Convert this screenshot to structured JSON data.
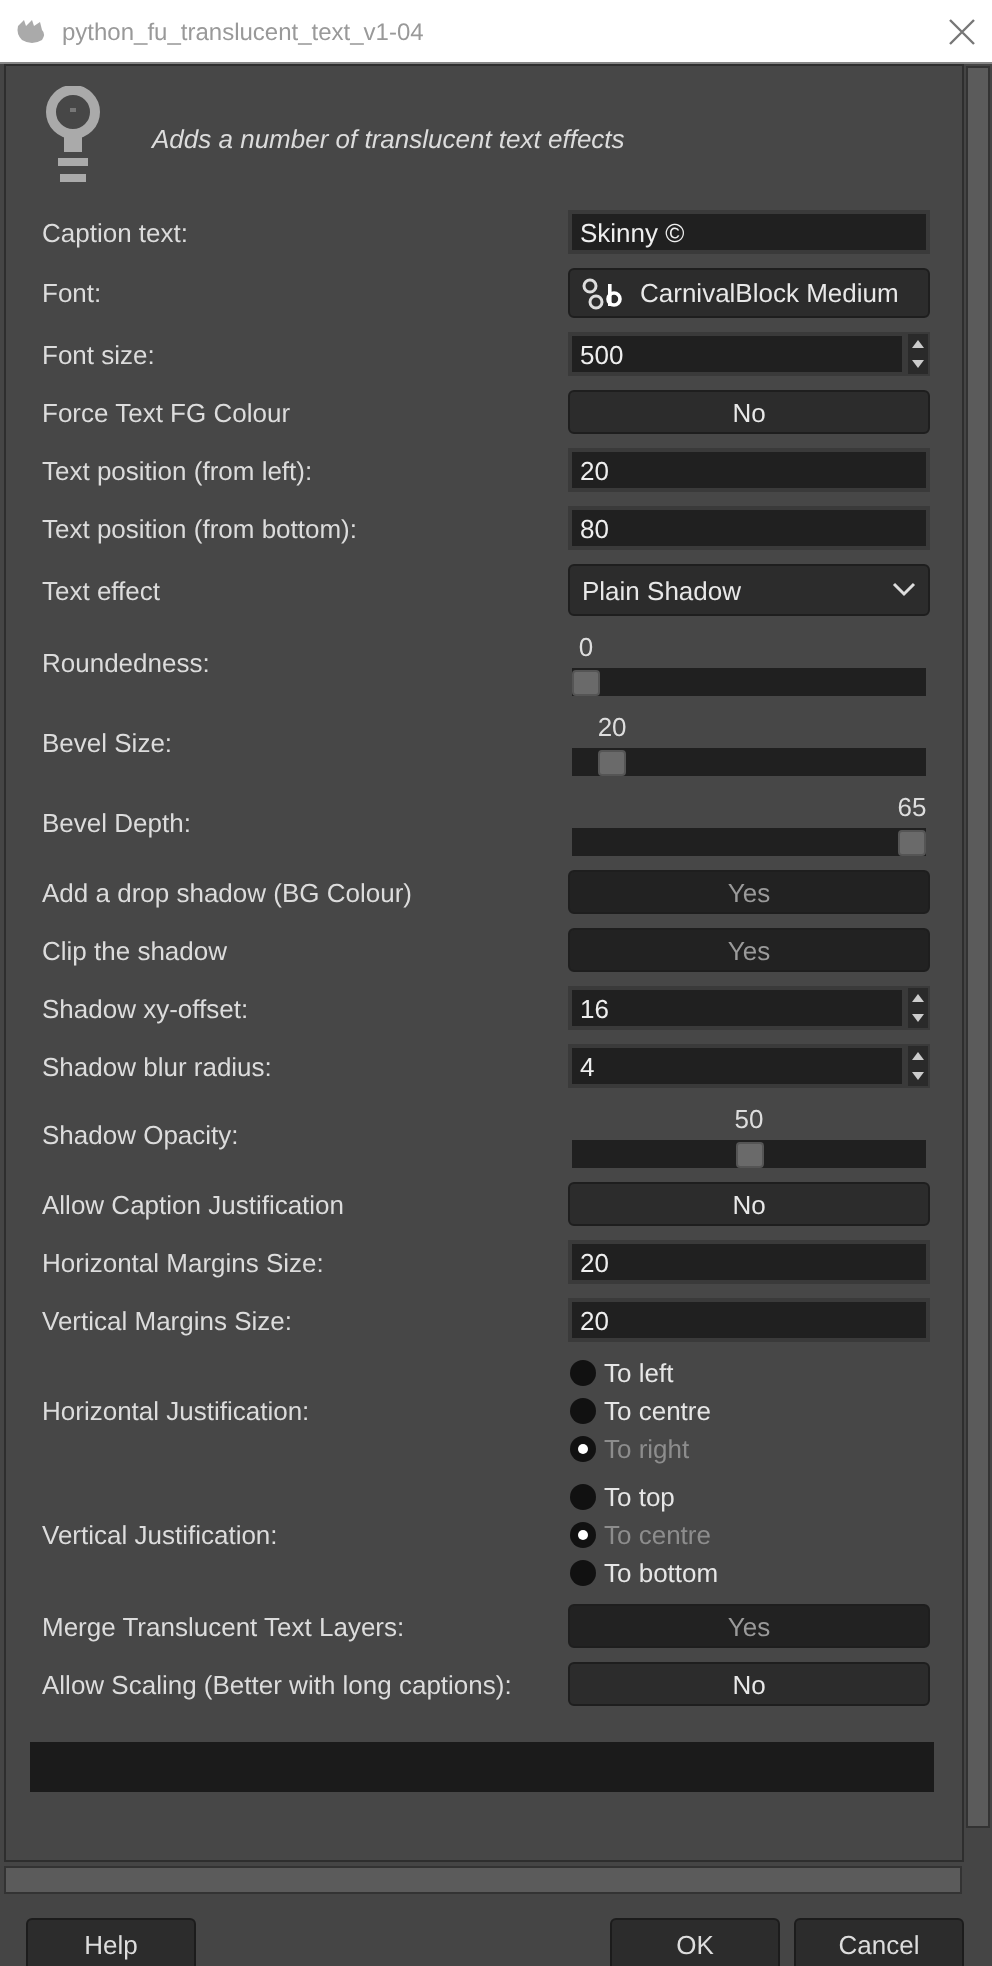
{
  "window": {
    "title": "python_fu_translucent_text_v1-04"
  },
  "description": "Adds a number of translucent text effects",
  "params": [
    {
      "kind": "text",
      "label": "Caption text:",
      "value": "Skinny ©"
    },
    {
      "kind": "font",
      "label": "Font:",
      "value": "CarnivalBlock Medium"
    },
    {
      "kind": "spin",
      "label": "Font size:",
      "value": "500"
    },
    {
      "kind": "toggle",
      "label": "Force Text FG Colour",
      "value": "No",
      "on": false
    },
    {
      "kind": "text",
      "label": "Text position (from left):",
      "value": "20"
    },
    {
      "kind": "text",
      "label": "Text position (from bottom):",
      "value": "80"
    },
    {
      "kind": "combo",
      "label": "Text effect",
      "value": "Plain Shadow"
    },
    {
      "kind": "slider",
      "label": "Roundedness:",
      "reading": "0",
      "level": 0
    },
    {
      "kind": "slider",
      "label": "Bevel Size:",
      "reading": "20",
      "level": 0.08
    },
    {
      "kind": "slider",
      "label": "Bevel Depth:",
      "reading": "65",
      "level": 1
    },
    {
      "kind": "toggle",
      "label": "Add a drop shadow (BG Colour)",
      "value": "Yes",
      "on": true
    },
    {
      "kind": "toggle",
      "label": "Clip the shadow",
      "value": "Yes",
      "on": true
    },
    {
      "kind": "spin",
      "label": "Shadow xy-offset:",
      "value": "16"
    },
    {
      "kind": "spin",
      "label": "Shadow blur radius:",
      "value": "4"
    },
    {
      "kind": "slider",
      "label": "Shadow Opacity:",
      "reading": "50",
      "level": 0.5
    },
    {
      "kind": "toggle",
      "label": "Allow Caption Justification",
      "value": "No",
      "on": false
    },
    {
      "kind": "text",
      "label": "Horizontal Margins Size:",
      "value": "20"
    },
    {
      "kind": "text",
      "label": "Vertical Margins Size:",
      "value": "20"
    },
    {
      "kind": "radio",
      "label": "Horizontal Justification:",
      "options": [
        {
          "label": "To left",
          "selected": false
        },
        {
          "label": "To centre",
          "selected": false
        },
        {
          "label": "To right",
          "selected": true
        }
      ]
    },
    {
      "kind": "radio",
      "label": "Vertical Justification:",
      "options": [
        {
          "label": "To top",
          "selected": false
        },
        {
          "label": "To centre",
          "selected": true
        },
        {
          "label": "To bottom",
          "selected": false
        }
      ]
    },
    {
      "kind": "toggle",
      "label": "Merge Translucent Text Layers:",
      "value": "Yes",
      "on": true
    },
    {
      "kind": "toggle",
      "label": "Allow Scaling (Better with long captions):",
      "value": "No",
      "on": false
    }
  ],
  "progress": {
    "level": 0
  },
  "buttons": [
    {
      "label": "Help"
    },
    {
      "label": "OK"
    },
    {
      "label": "Cancel"
    }
  ]
}
